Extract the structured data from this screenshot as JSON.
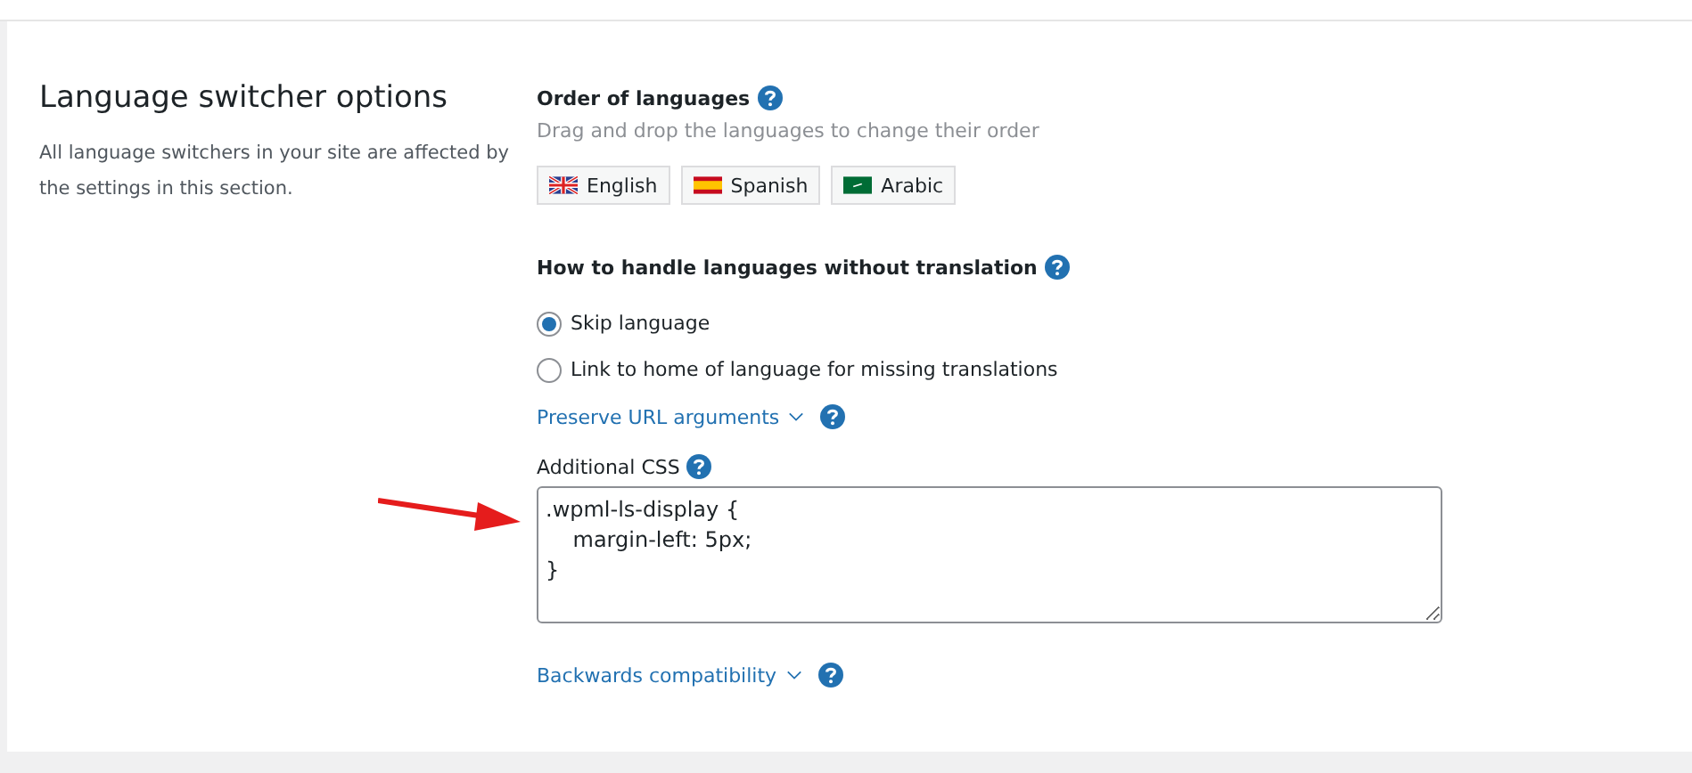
{
  "section": {
    "title": "Language switcher options",
    "description": "All language switchers in your site are affected by the settings in this section."
  },
  "order": {
    "label": "Order of languages",
    "hint": "Drag and drop the languages to change their order",
    "languages": [
      {
        "name": "English",
        "kind": "uk"
      },
      {
        "name": "Spanish",
        "kind": "es"
      },
      {
        "name": "Arabic",
        "kind": "sa"
      }
    ]
  },
  "missing": {
    "label": "How to handle languages without translation",
    "options": [
      {
        "label": "Skip language",
        "selected": true
      },
      {
        "label": "Link to home of language for missing translations",
        "selected": false
      }
    ]
  },
  "preserve": {
    "label": "Preserve URL arguments",
    "expanded": false
  },
  "css": {
    "label": "Additional CSS",
    "value": ".wpml-ls-display {\n    margin-left: 5px;\n}"
  },
  "backwards": {
    "label": "Backwards compatibility",
    "expanded": false
  }
}
